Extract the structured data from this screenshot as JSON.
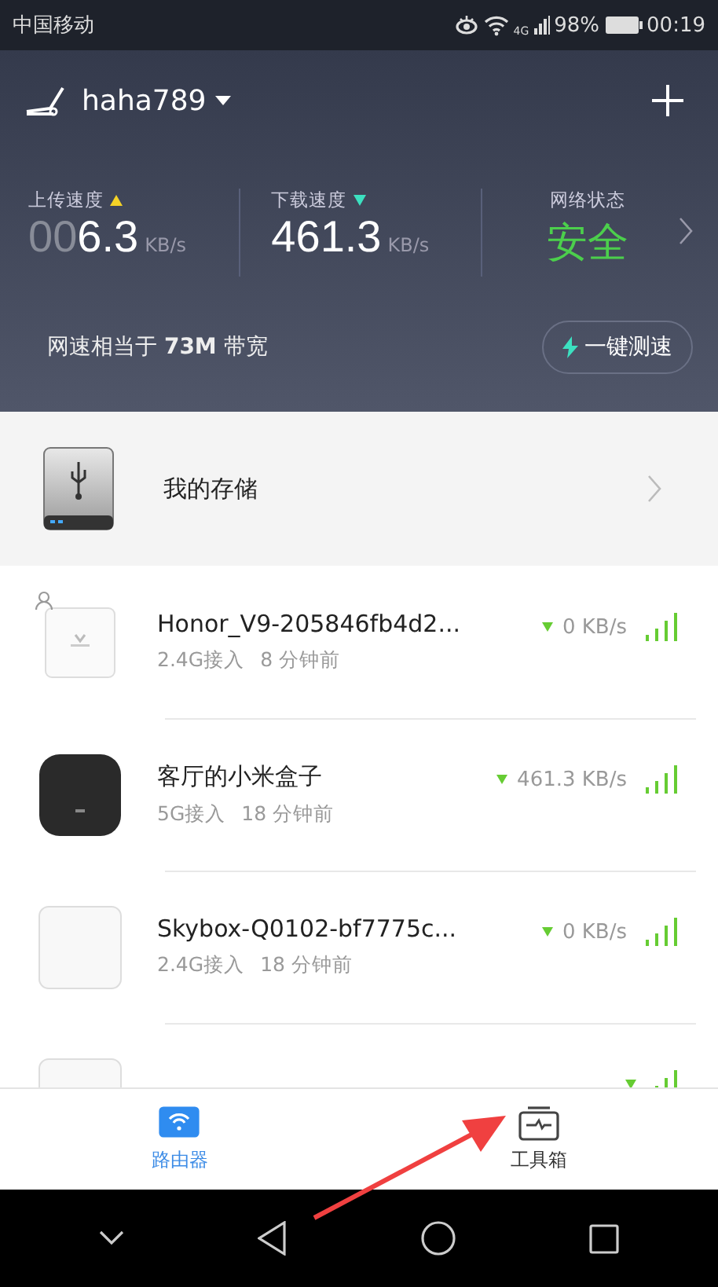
{
  "status_bar": {
    "carrier": "中国移动",
    "network": "4G",
    "battery": "98%",
    "time": "00:19"
  },
  "header": {
    "router_name": "haha789",
    "stats": [
      {
        "label": "上传速度",
        "kind": "upload",
        "dim_digits": "00",
        "value": "6.3",
        "unit": "KB/s"
      },
      {
        "label": "下载速度",
        "kind": "download",
        "value": "461.3",
        "unit": "KB/s"
      }
    ],
    "status": {
      "label": "网络状态",
      "value": "安全"
    },
    "bandwidth": "网速相当于 **73M** 带宽",
    "speed_test_button": "一键测速"
  },
  "storage": {
    "label": "我的存储"
  },
  "devices": [
    {
      "kind": "huawei",
      "user_badge": true,
      "name": "Honor_V9-205846fb4d2...",
      "band": "2.4G接入",
      "seen": "8 分钟前",
      "speed": "0 KB/s"
    },
    {
      "kind": "mibox",
      "user_badge": false,
      "name": "客厅的小米盒子",
      "band": "5G接入",
      "seen": "18 分钟前",
      "speed": "461.3 KB/s"
    },
    {
      "kind": "plain",
      "user_badge": false,
      "name": "Skybox-Q0102-bf7775c...",
      "band": "2.4G接入",
      "seen": "18 分钟前",
      "speed": "0 KB/s"
    },
    {
      "kind": "plain",
      "user_badge": false
    }
  ],
  "tabs": [
    {
      "label": "路由器",
      "kind": "router",
      "selected": true
    },
    {
      "label": "工具箱",
      "kind": "toolbox",
      "selected": false
    }
  ],
  "annotation": {
    "kind": "arrow"
  }
}
